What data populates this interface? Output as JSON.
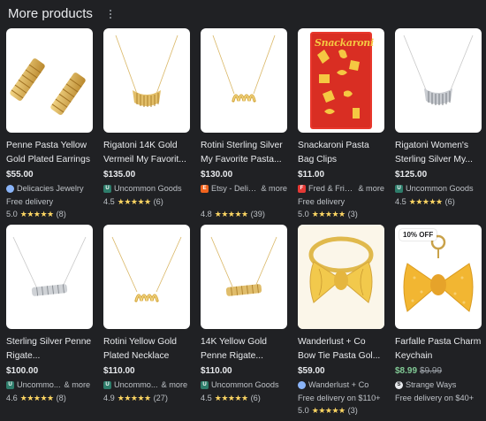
{
  "header": {
    "title": "More products"
  },
  "row1": [
    {
      "title": "Penne Pasta Yellow Gold Plated Earrings",
      "price": "$55.00",
      "seller": "Delicacies Jewelry",
      "seller_icon": "globe-icon",
      "seller_color": "#8ab4f8",
      "more": "",
      "delivery": "Free delivery",
      "rating": "5.0",
      "stars": "★★★★★",
      "reviews": "(8)",
      "product_icon": "penne-earrings"
    },
    {
      "title": "Rigatoni 14K Gold Vermeil My Favorit...",
      "price": "$135.00",
      "seller": "Uncommon Goods",
      "seller_icon": "uncommon-goods-logo",
      "seller_color": "#2e7d6b",
      "more": "",
      "delivery": "",
      "rating": "4.5",
      "stars": "★★★★★",
      "reviews": "(6)",
      "product_icon": "rigatoni-necklace"
    },
    {
      "title": "Rotini Sterling Silver My Favorite Pasta...",
      "price": "$130.00",
      "seller": "Etsy - Delic...",
      "seller_icon": "etsy-logo",
      "seller_color": "#f1641e",
      "more": "& more",
      "delivery": "",
      "rating": "4.8",
      "stars": "★★★★★",
      "reviews": "(39)",
      "product_icon": "rotini-necklace"
    },
    {
      "title": "Snackaroni Pasta Bag Clips",
      "price": "$11.00",
      "seller": "Fred & Frie...",
      "seller_icon": "fred-logo",
      "seller_color": "#e53935",
      "more": "& more",
      "delivery": "Free delivery",
      "rating": "5.0",
      "stars": "★★★★★",
      "reviews": "(3)",
      "product_icon": "snackaroni-package",
      "package_text": "Snackaroni"
    },
    {
      "title": "Rigatoni Women's Sterling Silver My...",
      "price": "$125.00",
      "seller": "Uncommon Goods",
      "seller_icon": "uncommon-goods-logo",
      "seller_color": "#2e7d6b",
      "more": "",
      "delivery": "",
      "rating": "4.5",
      "stars": "★★★★★",
      "reviews": "(6)",
      "product_icon": "silver-rigatoni-necklace"
    }
  ],
  "row2": [
    {
      "title": "Sterling Silver Penne Rigate...",
      "price": "$100.00",
      "seller": "Uncommo...",
      "seller_icon": "uncommon-goods-logo",
      "seller_color": "#2e7d6b",
      "more": "& more",
      "delivery": "",
      "rating": "4.6",
      "stars": "★★★★★",
      "reviews": "(8)",
      "product_icon": "silver-penne-necklace"
    },
    {
      "title": "Rotini Yellow Gold Plated Necklace",
      "price": "$110.00",
      "seller": "Uncommo...",
      "seller_icon": "uncommon-goods-logo",
      "seller_color": "#2e7d6b",
      "more": "& more",
      "delivery": "",
      "rating": "4.9",
      "stars": "★★★★★",
      "reviews": "(27)",
      "product_icon": "gold-rotini-necklace"
    },
    {
      "title": "14K Yellow Gold Penne Rigate...",
      "price": "$110.00",
      "seller": "Uncommon Goods",
      "seller_icon": "uncommon-goods-logo",
      "seller_color": "#2e7d6b",
      "more": "",
      "delivery": "",
      "rating": "4.5",
      "stars": "★★★★★",
      "reviews": "(6)",
      "product_icon": "gold-penne-necklace"
    },
    {
      "title": "Wanderlust + Co Bow Tie Pasta Gol...",
      "price": "$59.00",
      "seller": "Wanderlust + Co",
      "seller_icon": "globe-icon",
      "seller_color": "#8ab4f8",
      "more": "",
      "delivery": "Free delivery on $110+",
      "rating": "5.0",
      "stars": "★★★★★",
      "reviews": "(3)",
      "product_icon": "bowtie-ring"
    },
    {
      "title": "Farfalle Pasta Charm Keychain",
      "price": "$8.99",
      "old_price": "$9.99",
      "badge": "10% OFF",
      "seller": "Strange Ways",
      "seller_icon": "strange-ways-logo",
      "seller_color": "#3c4043",
      "more": "",
      "delivery": "Free delivery on $40+",
      "rating": "",
      "stars": "",
      "reviews": "",
      "product_icon": "farfalle-keychain"
    }
  ]
}
